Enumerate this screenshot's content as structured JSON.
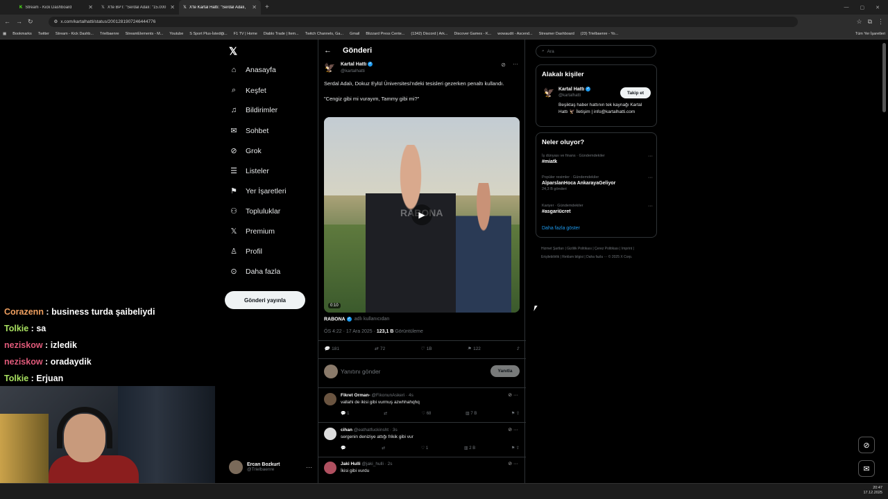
{
  "browser": {
    "tabs": [
      {
        "title": "Stream - Kick Dashboard",
        "icon": "kick-icon"
      },
      {
        "title": "X'te BPT: \"Serdal Adalı: \"15.000",
        "icon": "x-icon"
      },
      {
        "title": "X'te Kartal Hattı: \"Serdal Adalı,",
        "icon": "x-icon"
      }
    ],
    "url": "x.com/kartalhatti/status/2001281907246444776",
    "bookmarks": [
      "Bookmarks",
      "Twitter",
      "Stream - Kick Dashb...",
      "Trielbaenre",
      "StreamElements - M...",
      "Youtube",
      "S Sport Plus-İstediği...",
      "F1 TV | Home",
      "Diablo Trade | Item...",
      "Twitch Channels, Ga...",
      "Gmail",
      "Blizzard Press Cente...",
      "(1342) Discord | Ark...",
      "Discover Games - K...",
      "wowaudit - Ascend...",
      "Streamer Dashboard",
      "(23) Trielbaenre - Yo..."
    ],
    "bookmarks_right": "Tüm Yer İşaretleri"
  },
  "nav": {
    "items": [
      "Anasayfa",
      "Keşfet",
      "Bildirimler",
      "Sohbet",
      "Grok",
      "Listeler",
      "Yer İşaretleri",
      "Topluluklar",
      "Premium",
      "Profil",
      "Daha fazla"
    ],
    "post_button": "Gönderi yayınla",
    "user_name": "Ercan Bozkurt",
    "user_handle": "@Trielbaenre"
  },
  "post": {
    "header": "Gönderi",
    "author_name": "Kartal Hattı",
    "author_handle": "@kartalhatti",
    "text1": "Serdal Adalı, Dokuz Eylül Üniversitesi'ndeki tesisleri gezerken penaltı kullandı.",
    "text2": "\"Cengiz gibi mi vurayım, Tammy gibi mi?\"",
    "video_duration": "0:10",
    "video_watermark": "RABONA",
    "source_name": "RABONA",
    "source_by": "adlı kullanıcıdan",
    "time": "ÖS 4:22 · 17 Ara 2025 · ",
    "views": "123,1 B",
    "views_label": " Görüntüleme",
    "replies": "181",
    "reposts": "72",
    "likes": "1B",
    "bookmarks": "122",
    "reply_placeholder": "Yanıtını gönder",
    "reply_button": "Yanıtla"
  },
  "comments": [
    {
      "name": "Fikret Orman-",
      "handle": "@FikonunAskeri · 4s",
      "text": "vallahi de ikisi gibi vurmuş azwhhahqhq",
      "replies": "1",
      "likes": "68",
      "views": "7 B"
    },
    {
      "name": "cihan",
      "handle": "@eathatfuckinsht · 3s",
      "text": "sergenin deniziye attığı frikik gibi vur",
      "replies": "",
      "likes": "1",
      "views": "2 B"
    },
    {
      "name": "Jaki Hulli",
      "handle": "@jaki_hulli · 2s",
      "text": "İkisi gibi vurdu",
      "replies": "",
      "likes": "",
      "views": ""
    }
  ],
  "sidebar": {
    "search_placeholder": "Ara",
    "related_title": "Alakalı kişiler",
    "related_name": "Kartal Hattı",
    "related_handle": "@kartalhatti",
    "follow_button": "Takip et",
    "related_bio": "Beşiktaş haber hattının tek kaynağı Kartal Hattı 🦅 İletişim | info@kartalhatti.com",
    "trends_title": "Neler oluyor?",
    "trends": [
      {
        "category": "İş dünyası ve finans · Gündemdekiler",
        "topic": "#miatk",
        "count": ""
      },
      {
        "category": "Popüler resimler · Gündemdekiler",
        "topic": "AlparslanHoca AnkarayaGeliyor",
        "count": "24,3 B gönderi"
      },
      {
        "category": "Kariyer · Gündemdekiler",
        "topic": "#asgariücret",
        "count": ""
      }
    ],
    "show_more": "Daha fazla göster",
    "footer": "Hizmet Şartları | Gizlilik Politikası | Çerez Politikası | Imprint | Erişilebilirlik | Reklam bilgisi | Daha fazla ··· © 2025 X Corp."
  },
  "stream_chat": [
    {
      "user": "Corazenn",
      "color": "#f0a060",
      "msg": "business turda şaibeliydi"
    },
    {
      "user": "Tolkie",
      "color": "#a8e060",
      "msg": "sa"
    },
    {
      "user": "neziskow",
      "color": "#e05a7a",
      "msg": "izledik"
    },
    {
      "user": "neziskow",
      "color": "#e05a7a",
      "msg": "oradaydik"
    },
    {
      "user": "Tolkie",
      "color": "#a8e060",
      "msg": "Erjuan"
    }
  ],
  "taskbar": {
    "time": "20:47",
    "date": "17.12.2025"
  },
  "colors": {
    "accent": "#1d9bf0",
    "bg": "#000000",
    "border": "#2f3336"
  }
}
